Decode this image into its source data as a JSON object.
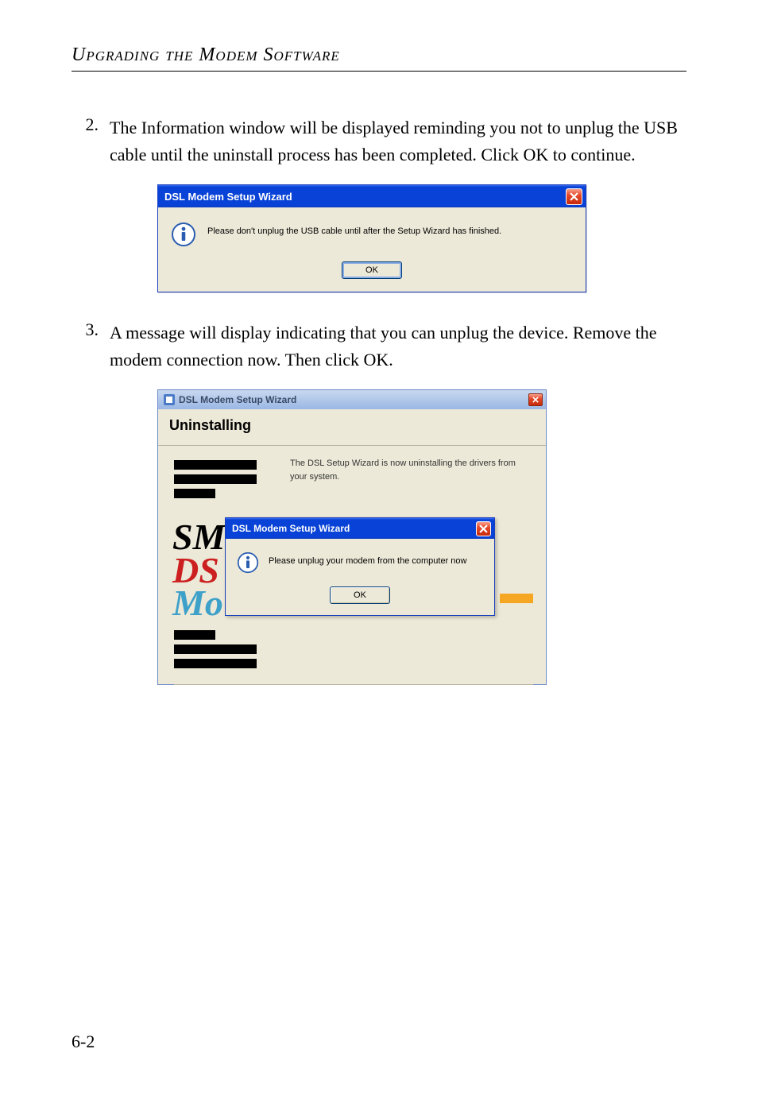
{
  "section_title": "Upgrading the Modem Software",
  "steps": [
    {
      "num": "2.",
      "text": "The Information window will be displayed reminding you not to unplug the USB cable until the uninstall process has been completed. Click OK to continue."
    },
    {
      "num": "3.",
      "text": "A message will display indicating that you can unplug the device. Remove the modem connection now. Then click OK."
    }
  ],
  "dialog1": {
    "title": "DSL Modem Setup Wizard",
    "message": "Please don't unplug the USB cable until after the Setup Wizard has finished.",
    "ok_label": "OK"
  },
  "dialog2": {
    "title": "DSL Modem Setup Wizard",
    "heading": "Uninstalling",
    "description": "The DSL Setup Wizard is now uninstalling the drivers from your system.",
    "brand_sm": "SM",
    "brand_ds": "DS",
    "brand_mo": "Mo"
  },
  "dialog3": {
    "title": "DSL Modem Setup Wizard",
    "message": "Please unplug your modem from the computer now",
    "ok_label": "OK"
  },
  "page_number": "6-2"
}
